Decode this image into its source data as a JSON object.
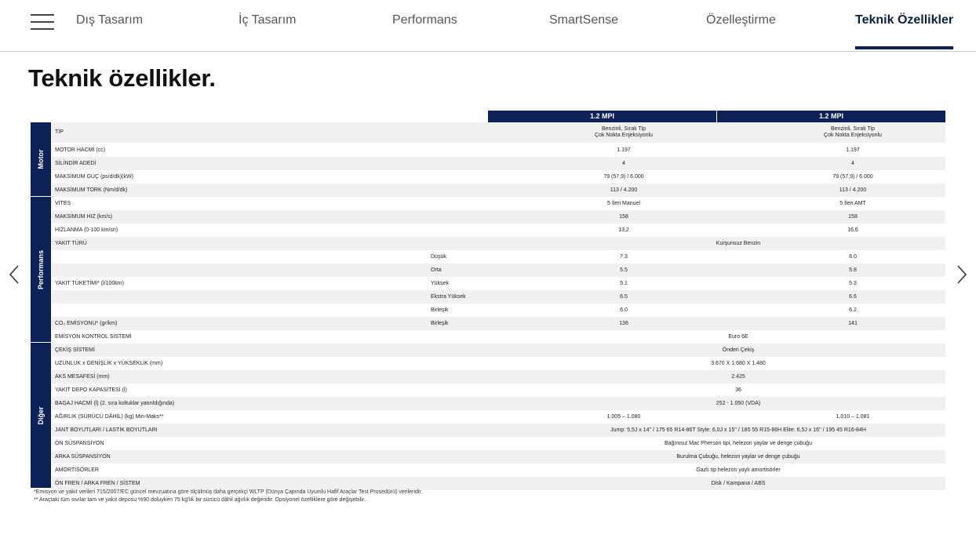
{
  "nav": {
    "tabs": [
      {
        "label": "Dış Tasarım",
        "active": false
      },
      {
        "label": "İç Tasarım",
        "active": false
      },
      {
        "label": "Performans",
        "active": false
      },
      {
        "label": "SmartSense",
        "active": false
      },
      {
        "label": "Özelleştirme",
        "active": false
      },
      {
        "label": "Teknik Özellikler",
        "active": true
      }
    ]
  },
  "page": {
    "title": "Teknik özellikler."
  },
  "table": {
    "columns": [
      "1.2 MPI",
      "1.2 MPI"
    ],
    "groups": [
      "Motor",
      "Performans",
      "Diğer"
    ],
    "rows": [
      {
        "label": "TİP",
        "sub": "",
        "v1": "Benzinli, Sıralı Tip\nÇok Nokta Enjeksiyonlu",
        "v2": "Benzinli, Sıralı Tip\nÇok Nokta Enjeksiyonlu",
        "span": ""
      },
      {
        "label": "MOTOR HACMİ (cc)",
        "sub": "",
        "v1": "1.197",
        "v2": "1.197",
        "span": ""
      },
      {
        "label": "SİLİNDİR ADEDİ",
        "sub": "",
        "v1": "4",
        "v2": "4",
        "span": ""
      },
      {
        "label": "MAKSİMUM GÜÇ (ps/d/dk)(kW)",
        "sub": "",
        "v1": "79 (57,9) / 6.000",
        "v2": "79 (57,9) / 6.000",
        "span": ""
      },
      {
        "label": "MAKSİMUM TORK (Nm/d/dk)",
        "sub": "",
        "v1": "113 / 4.200",
        "v2": "113 / 4.200",
        "span": ""
      },
      {
        "label": "VİTES",
        "sub": "",
        "v1": "5 İleri Manuel",
        "v2": "5 İleri AMT",
        "span": ""
      },
      {
        "label": "MAKSİMUM HIZ (km/s)",
        "sub": "",
        "v1": "158",
        "v2": "158",
        "span": ""
      },
      {
        "label": "HIZLANMA (0-100 km/sn)",
        "sub": "",
        "v1": "13,2",
        "v2": "16,6",
        "span": ""
      },
      {
        "label": "YAKIT TÜRÜ",
        "sub": "",
        "v1": "",
        "v2": "",
        "span": "Kurşunsuz Benzin"
      },
      {
        "label": "",
        "sub": "Düşük",
        "v1": "7.3",
        "v2": "8.0",
        "span": ""
      },
      {
        "label": "",
        "sub": "Orta",
        "v1": "5.5",
        "v2": "5.8",
        "span": ""
      },
      {
        "label": "YAKIT TÜKETİMİ* (l/100km)",
        "sub": "Yüksek",
        "v1": "5.1",
        "v2": "5.3",
        "span": ""
      },
      {
        "label": "",
        "sub": "Ekstra Yüksek",
        "v1": "6.5",
        "v2": "6.6",
        "span": ""
      },
      {
        "label": "",
        "sub": "Birleşik",
        "v1": "6.0",
        "v2": "6.2",
        "span": ""
      },
      {
        "label": "CO₂ EMİSYONU* (gr/km)",
        "sub": "Birleşik",
        "v1": "136",
        "v2": "141",
        "span": ""
      },
      {
        "label": "EMİSYON KONTROL SİSTEMİ",
        "sub": "",
        "v1": "",
        "v2": "",
        "span": "Euro 6E"
      },
      {
        "label": "ÇEKİŞ SİSTEMİ",
        "sub": "",
        "v1": "",
        "v2": "",
        "span": "Önden Çekiş"
      },
      {
        "label": "UZUNLUK x GENİŞLİK x YÜKSEKLİK (mm)",
        "sub": "",
        "v1": "",
        "v2": "",
        "span": "3.670 X 1.680 X 1.480"
      },
      {
        "label": "AKS MESAFESİ (mm)",
        "sub": "",
        "v1": "",
        "v2": "",
        "span": "2.425"
      },
      {
        "label": "YAKIT DEPO KAPASİTESİ (l)",
        "sub": "",
        "v1": "",
        "v2": "",
        "span": "36"
      },
      {
        "label": "BAGAJ HACMİ (l) (2. sıra koltuklar yatırıldığında)",
        "sub": "",
        "v1": "",
        "v2": "",
        "span": "252 - 1.050 (VDA)"
      },
      {
        "label": "AĞIRLIK (SÜRÜCÜ DÂHİL) (kg) Min-Maks**",
        "sub": "",
        "v1": "1.005 – 1.080",
        "v2": "1.010 – 1.081",
        "span": ""
      },
      {
        "label": "JANT BOYUTLARI / LASTİK BOYUTLARI",
        "sub": "",
        "v1": "",
        "v2": "",
        "span": "Jump: 5,5J x 14'' / 175 65 R14-86T   Style: 6,0J x 15'' / 185 55 R15-86H   Elite: 6,5J x 16'' / 195 45 R16-84H"
      },
      {
        "label": "ÖN SÜSPANSİYON",
        "sub": "",
        "v1": "",
        "v2": "",
        "span": "Bağımsız Mac Pherson tipi, helezon yaylar ve denge çubuğu"
      },
      {
        "label": "ARKA SÜSPANSİYON",
        "sub": "",
        "v1": "",
        "v2": "",
        "span": "Burulma Çubuğu, helezon yaylar ve denge çubuğu"
      },
      {
        "label": "AMORTİSÖRLER",
        "sub": "",
        "v1": "",
        "v2": "",
        "span": "Gazlı tip helezon yaylı amortisörler"
      },
      {
        "label": "ÖN FREN / ARKA FREN / SİSTEM",
        "sub": "",
        "v1": "",
        "v2": "",
        "span": "Disk / Kampana / ABS"
      }
    ],
    "footnotes": [
      "*Emisyon ve yakıt verileri 715/2007/EC güncel mevzuatına göre ölçülmüş daha gerçekçi WLTP (Dünya Çapında Uyumlu Hafif Araçlar Test Prosedürü) verileridir.",
      "** Araçtaki tüm sıvılar tam ve yakıt deposu %90 doluyken 75 kg'lık bir sürücü dâhil ağırlık değeridir. Opsiyonel özelliklere göre değişebilir."
    ]
  },
  "icons": {
    "menu": "hamburger-menu-icon",
    "prev": "chevron-left-icon",
    "next": "chevron-right-icon"
  },
  "colors": {
    "accent": "#0c2157",
    "row_shade": "#f0f0f0"
  }
}
